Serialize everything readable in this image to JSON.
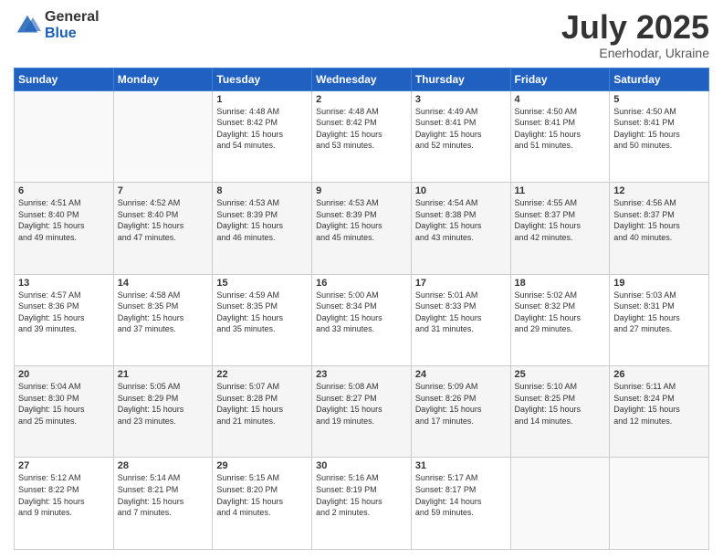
{
  "logo": {
    "general": "General",
    "blue": "Blue"
  },
  "header": {
    "month": "July 2025",
    "location": "Enerhodar, Ukraine"
  },
  "weekdays": [
    "Sunday",
    "Monday",
    "Tuesday",
    "Wednesday",
    "Thursday",
    "Friday",
    "Saturday"
  ],
  "weeks": [
    [
      {
        "day": "",
        "content": ""
      },
      {
        "day": "",
        "content": ""
      },
      {
        "day": "1",
        "content": "Sunrise: 4:48 AM\nSunset: 8:42 PM\nDaylight: 15 hours\nand 54 minutes."
      },
      {
        "day": "2",
        "content": "Sunrise: 4:48 AM\nSunset: 8:42 PM\nDaylight: 15 hours\nand 53 minutes."
      },
      {
        "day": "3",
        "content": "Sunrise: 4:49 AM\nSunset: 8:41 PM\nDaylight: 15 hours\nand 52 minutes."
      },
      {
        "day": "4",
        "content": "Sunrise: 4:50 AM\nSunset: 8:41 PM\nDaylight: 15 hours\nand 51 minutes."
      },
      {
        "day": "5",
        "content": "Sunrise: 4:50 AM\nSunset: 8:41 PM\nDaylight: 15 hours\nand 50 minutes."
      }
    ],
    [
      {
        "day": "6",
        "content": "Sunrise: 4:51 AM\nSunset: 8:40 PM\nDaylight: 15 hours\nand 49 minutes."
      },
      {
        "day": "7",
        "content": "Sunrise: 4:52 AM\nSunset: 8:40 PM\nDaylight: 15 hours\nand 47 minutes."
      },
      {
        "day": "8",
        "content": "Sunrise: 4:53 AM\nSunset: 8:39 PM\nDaylight: 15 hours\nand 46 minutes."
      },
      {
        "day": "9",
        "content": "Sunrise: 4:53 AM\nSunset: 8:39 PM\nDaylight: 15 hours\nand 45 minutes."
      },
      {
        "day": "10",
        "content": "Sunrise: 4:54 AM\nSunset: 8:38 PM\nDaylight: 15 hours\nand 43 minutes."
      },
      {
        "day": "11",
        "content": "Sunrise: 4:55 AM\nSunset: 8:37 PM\nDaylight: 15 hours\nand 42 minutes."
      },
      {
        "day": "12",
        "content": "Sunrise: 4:56 AM\nSunset: 8:37 PM\nDaylight: 15 hours\nand 40 minutes."
      }
    ],
    [
      {
        "day": "13",
        "content": "Sunrise: 4:57 AM\nSunset: 8:36 PM\nDaylight: 15 hours\nand 39 minutes."
      },
      {
        "day": "14",
        "content": "Sunrise: 4:58 AM\nSunset: 8:35 PM\nDaylight: 15 hours\nand 37 minutes."
      },
      {
        "day": "15",
        "content": "Sunrise: 4:59 AM\nSunset: 8:35 PM\nDaylight: 15 hours\nand 35 minutes."
      },
      {
        "day": "16",
        "content": "Sunrise: 5:00 AM\nSunset: 8:34 PM\nDaylight: 15 hours\nand 33 minutes."
      },
      {
        "day": "17",
        "content": "Sunrise: 5:01 AM\nSunset: 8:33 PM\nDaylight: 15 hours\nand 31 minutes."
      },
      {
        "day": "18",
        "content": "Sunrise: 5:02 AM\nSunset: 8:32 PM\nDaylight: 15 hours\nand 29 minutes."
      },
      {
        "day": "19",
        "content": "Sunrise: 5:03 AM\nSunset: 8:31 PM\nDaylight: 15 hours\nand 27 minutes."
      }
    ],
    [
      {
        "day": "20",
        "content": "Sunrise: 5:04 AM\nSunset: 8:30 PM\nDaylight: 15 hours\nand 25 minutes."
      },
      {
        "day": "21",
        "content": "Sunrise: 5:05 AM\nSunset: 8:29 PM\nDaylight: 15 hours\nand 23 minutes."
      },
      {
        "day": "22",
        "content": "Sunrise: 5:07 AM\nSunset: 8:28 PM\nDaylight: 15 hours\nand 21 minutes."
      },
      {
        "day": "23",
        "content": "Sunrise: 5:08 AM\nSunset: 8:27 PM\nDaylight: 15 hours\nand 19 minutes."
      },
      {
        "day": "24",
        "content": "Sunrise: 5:09 AM\nSunset: 8:26 PM\nDaylight: 15 hours\nand 17 minutes."
      },
      {
        "day": "25",
        "content": "Sunrise: 5:10 AM\nSunset: 8:25 PM\nDaylight: 15 hours\nand 14 minutes."
      },
      {
        "day": "26",
        "content": "Sunrise: 5:11 AM\nSunset: 8:24 PM\nDaylight: 15 hours\nand 12 minutes."
      }
    ],
    [
      {
        "day": "27",
        "content": "Sunrise: 5:12 AM\nSunset: 8:22 PM\nDaylight: 15 hours\nand 9 minutes."
      },
      {
        "day": "28",
        "content": "Sunrise: 5:14 AM\nSunset: 8:21 PM\nDaylight: 15 hours\nand 7 minutes."
      },
      {
        "day": "29",
        "content": "Sunrise: 5:15 AM\nSunset: 8:20 PM\nDaylight: 15 hours\nand 4 minutes."
      },
      {
        "day": "30",
        "content": "Sunrise: 5:16 AM\nSunset: 8:19 PM\nDaylight: 15 hours\nand 2 minutes."
      },
      {
        "day": "31",
        "content": "Sunrise: 5:17 AM\nSunset: 8:17 PM\nDaylight: 14 hours\nand 59 minutes."
      },
      {
        "day": "",
        "content": ""
      },
      {
        "day": "",
        "content": ""
      }
    ]
  ]
}
